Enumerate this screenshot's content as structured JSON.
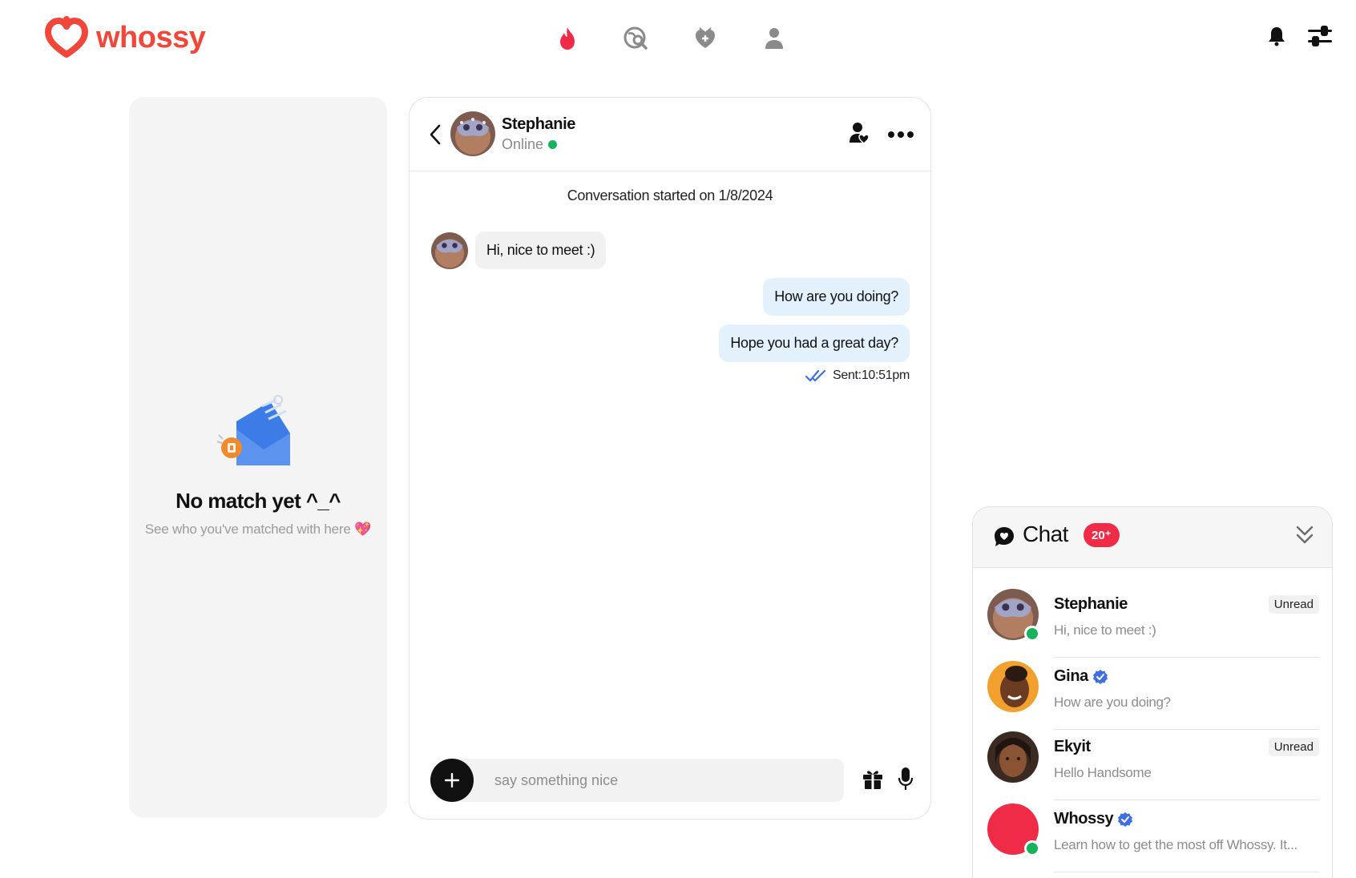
{
  "app": {
    "logo_text": "whossy",
    "brand_color": "#f0473a",
    "accent_red": "#f02b47",
    "online_color": "#17b35a"
  },
  "topnav": [
    {
      "icon": "flame-icon",
      "active": true
    },
    {
      "icon": "explore-search-icon",
      "active": false
    },
    {
      "icon": "heart-shield-icon",
      "active": false
    },
    {
      "icon": "profile-icon",
      "active": false
    }
  ],
  "top_right": {
    "notifications_icon": "bell-icon",
    "filters_icon": "sliders-icon"
  },
  "matches": {
    "empty_title": "No match yet ^_^",
    "empty_subtitle": "See who you've matched with here",
    "empty_emoji": "💖"
  },
  "conversation": {
    "contact_name": "Stephanie",
    "contact_status": "Online",
    "started_text": "Conversation started on 1/8/2024",
    "messages": [
      {
        "direction": "in",
        "text": "Hi, nice to meet :)"
      },
      {
        "direction": "out",
        "text": "How are you doing?"
      },
      {
        "direction": "out",
        "text": "Hope you had a great day?"
      }
    ],
    "sent_status": "Sent:10:51pm",
    "composer_placeholder": "say something nice"
  },
  "chat_widget": {
    "title": "Chat",
    "badge": "20⁺",
    "items": [
      {
        "name": "Stephanie",
        "preview": "Hi, nice to meet :)",
        "unread_label": "Unread",
        "verified": false,
        "online": true
      },
      {
        "name": "Gina",
        "preview": "How are you doing?",
        "unread_label": "",
        "verified": true,
        "online": false
      },
      {
        "name": "Ekyit",
        "preview": "Hello Handsome",
        "unread_label": "Unread",
        "verified": false,
        "online": false
      },
      {
        "name": "Whossy",
        "preview": "Learn how to get the most off Whossy. It...",
        "unread_label": "",
        "verified": true,
        "online": true
      }
    ]
  }
}
